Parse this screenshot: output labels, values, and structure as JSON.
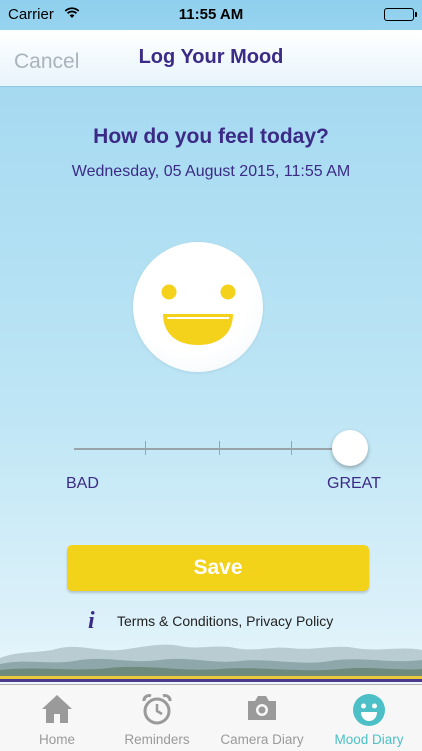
{
  "status_bar": {
    "carrier": "Carrier",
    "time": "11:55 AM",
    "battery_level": 1.0
  },
  "nav": {
    "cancel_label": "Cancel",
    "title": "Log Your Mood"
  },
  "main": {
    "question": "How do you feel today?",
    "datetime": "Wednesday, 05 August 2015,  11:55 AM",
    "face_icon": "happy-face-icon",
    "slider": {
      "min_label": "BAD",
      "max_label": "GREAT",
      "value": 1.0,
      "steps": 5
    },
    "save_label": "Save",
    "info_icon": "info-icon",
    "terms_label": "Terms & Conditions, Privacy Policy"
  },
  "tabs": [
    {
      "label": "Home",
      "icon": "home-icon",
      "active": false
    },
    {
      "label": "Reminders",
      "icon": "alarm-clock-icon",
      "active": false
    },
    {
      "label": "Camera Diary",
      "icon": "camera-icon",
      "active": false
    },
    {
      "label": "Mood Diary",
      "icon": "smiley-icon",
      "active": true
    }
  ],
  "colors": {
    "brand_purple": "#3b2b86",
    "save_yellow": "#f3d21a",
    "face_yellow": "#f4d21c",
    "tab_active": "#4cc0c6",
    "tab_inactive": "#9a9a9a"
  }
}
